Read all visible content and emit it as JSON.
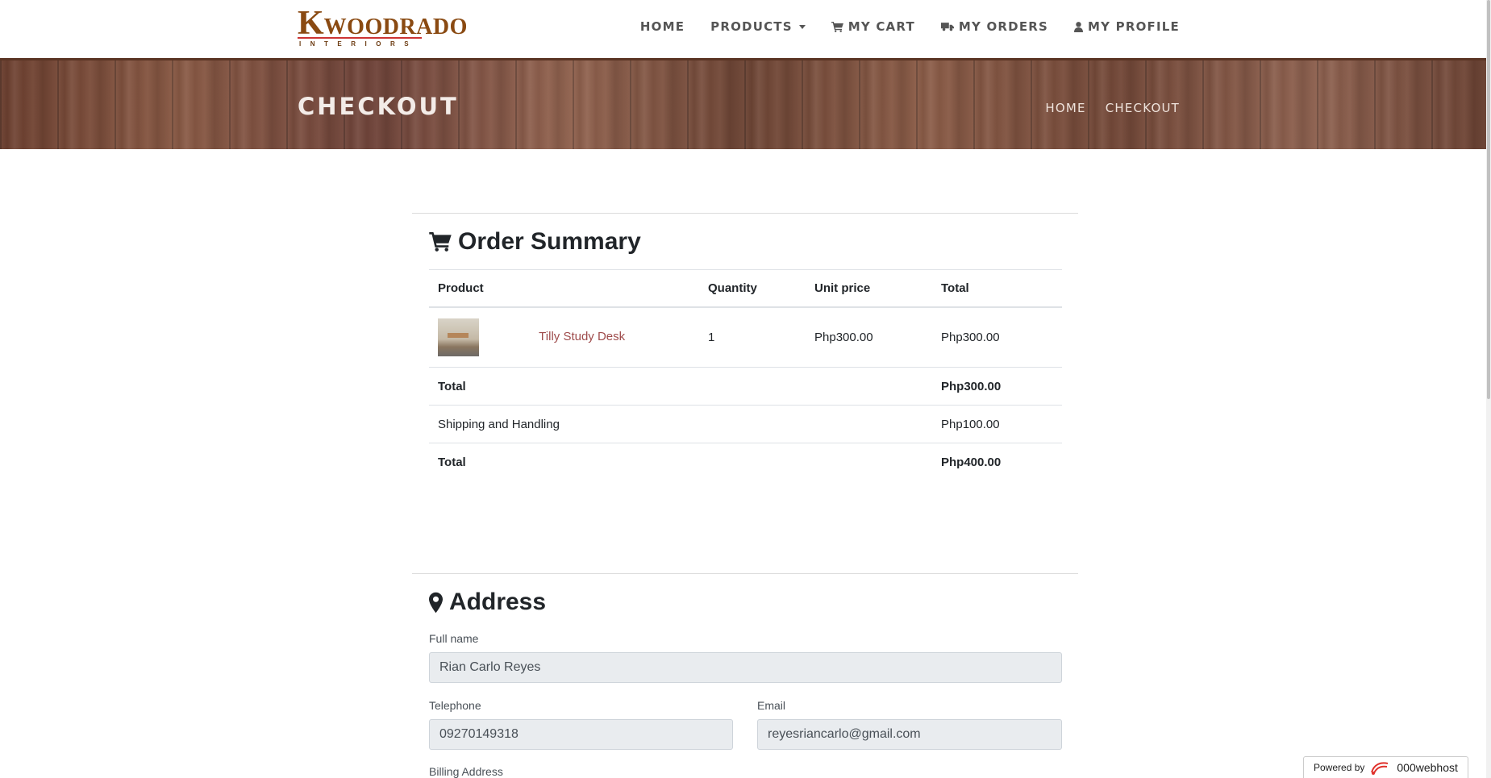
{
  "brand": {
    "logo_main_letter": "K",
    "logo_main_rest": "WOODRADO",
    "logo_sub": "INTERIORS"
  },
  "nav": {
    "home": "HOME",
    "products": "PRODUCTS",
    "cart": "MY CART",
    "orders": "MY ORDERS",
    "profile": "MY PROFILE"
  },
  "banner": {
    "title": "CHECKOUT",
    "crumbs": [
      "HOME",
      "CHECKOUT"
    ]
  },
  "order_summary": {
    "title": "Order Summary",
    "columns": [
      "Product",
      "Quantity",
      "Unit price",
      "Total"
    ],
    "items": [
      {
        "name": "Tilly Study Desk",
        "quantity": "1",
        "unit_price": "Php300.00",
        "total": "Php300.00"
      }
    ],
    "subtotal_label": "Total",
    "subtotal": "Php300.00",
    "shipping_label": "Shipping and Handling",
    "shipping": "Php100.00",
    "grand_total_label": "Total",
    "grand_total": "Php400.00"
  },
  "address": {
    "title": "Address",
    "full_name_label": "Full name",
    "full_name": "Rian Carlo Reyes",
    "telephone_label": "Telephone",
    "telephone": "09270149318",
    "email_label": "Email",
    "email": "reyesriancarlo@gmail.com",
    "billing_label": "Billing Address"
  },
  "footer_badge": {
    "powered_by": "Powered by",
    "host": "000webhost"
  },
  "colors": {
    "accent_link": "#9e4b4b",
    "logo_brown": "#8a4a12",
    "field_bg": "#e9ecef"
  }
}
